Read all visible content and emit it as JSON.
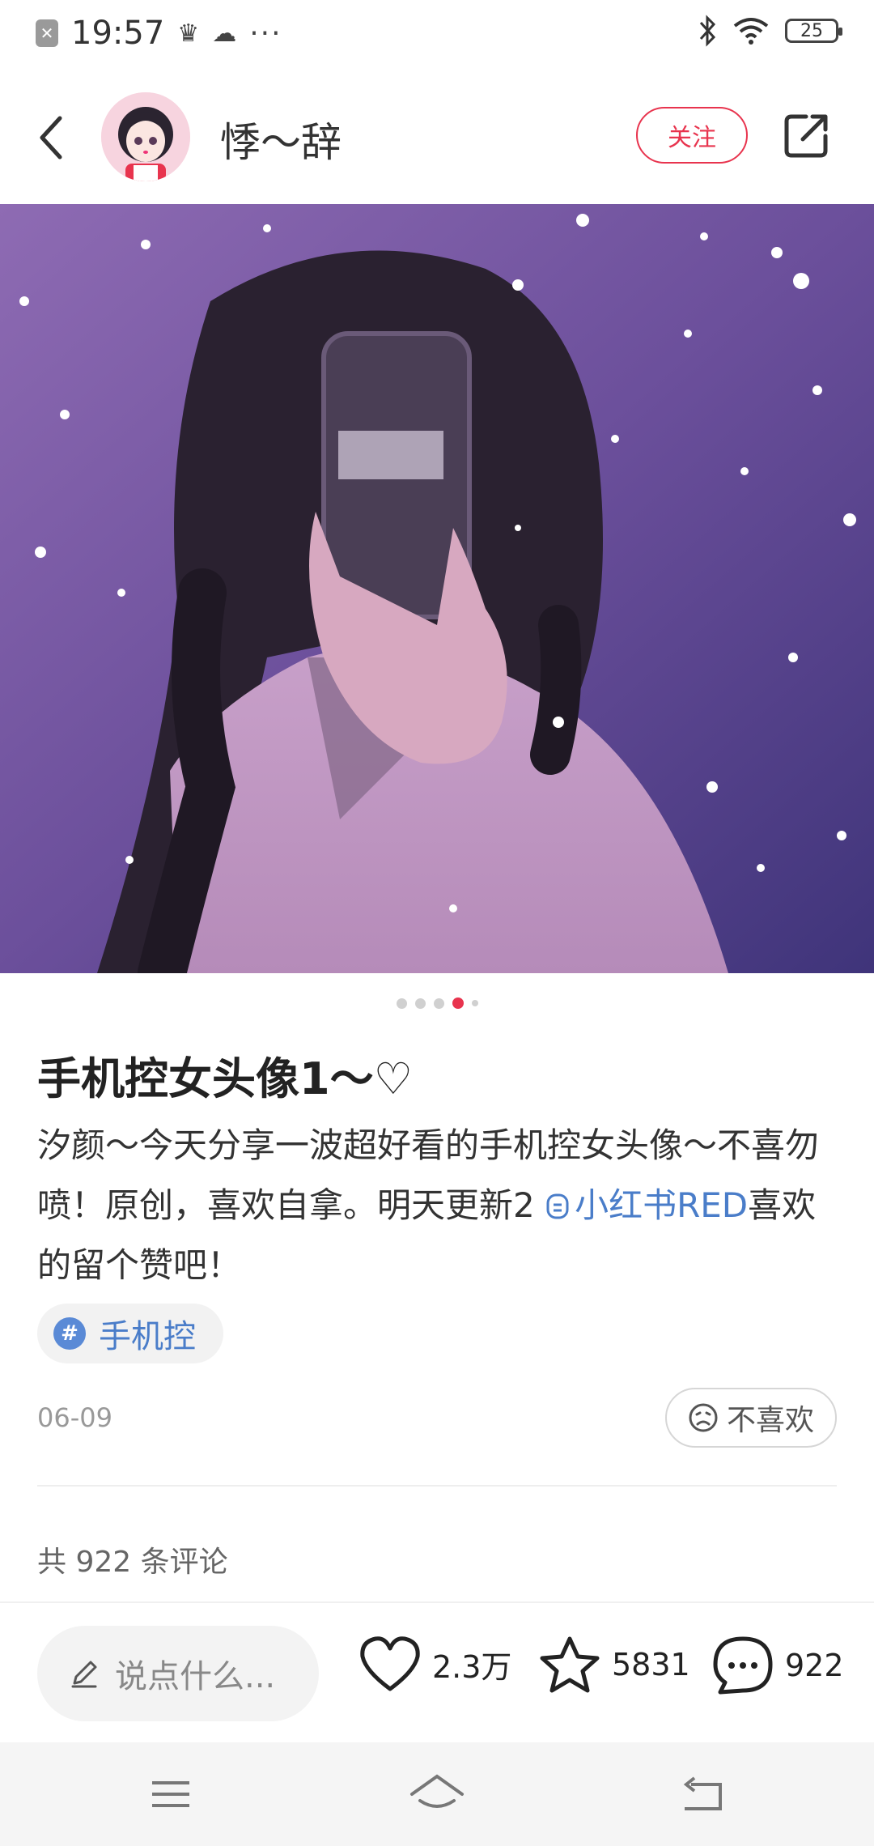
{
  "status": {
    "time": "19:57",
    "dots": "···",
    "battery": "25"
  },
  "header": {
    "username": "悸～辞",
    "follow_label": "关注"
  },
  "carousel": {
    "count": 5,
    "active": 4
  },
  "post": {
    "title": "手机控女头像1～",
    "title_heart": "♡",
    "desc_part1": "汐颜～今天分享一波超好看的手机控女头像～不喜勿喷！原创，喜欢自拿。明天更新2 ",
    "desc_link": "小红书RED",
    "desc_part2": "喜欢的留个赞吧！",
    "tag": "手机控",
    "tag_icon": "#",
    "date": "06-09",
    "dislike_label": "不喜欢",
    "comment_count_label": "共 922 条评论"
  },
  "actions": {
    "input_placeholder": "说点什么...",
    "likes": "2.3万",
    "collects": "5831",
    "comments": "922"
  },
  "colors": {
    "accent": "#e8344e",
    "link": "#4a7dc9"
  }
}
